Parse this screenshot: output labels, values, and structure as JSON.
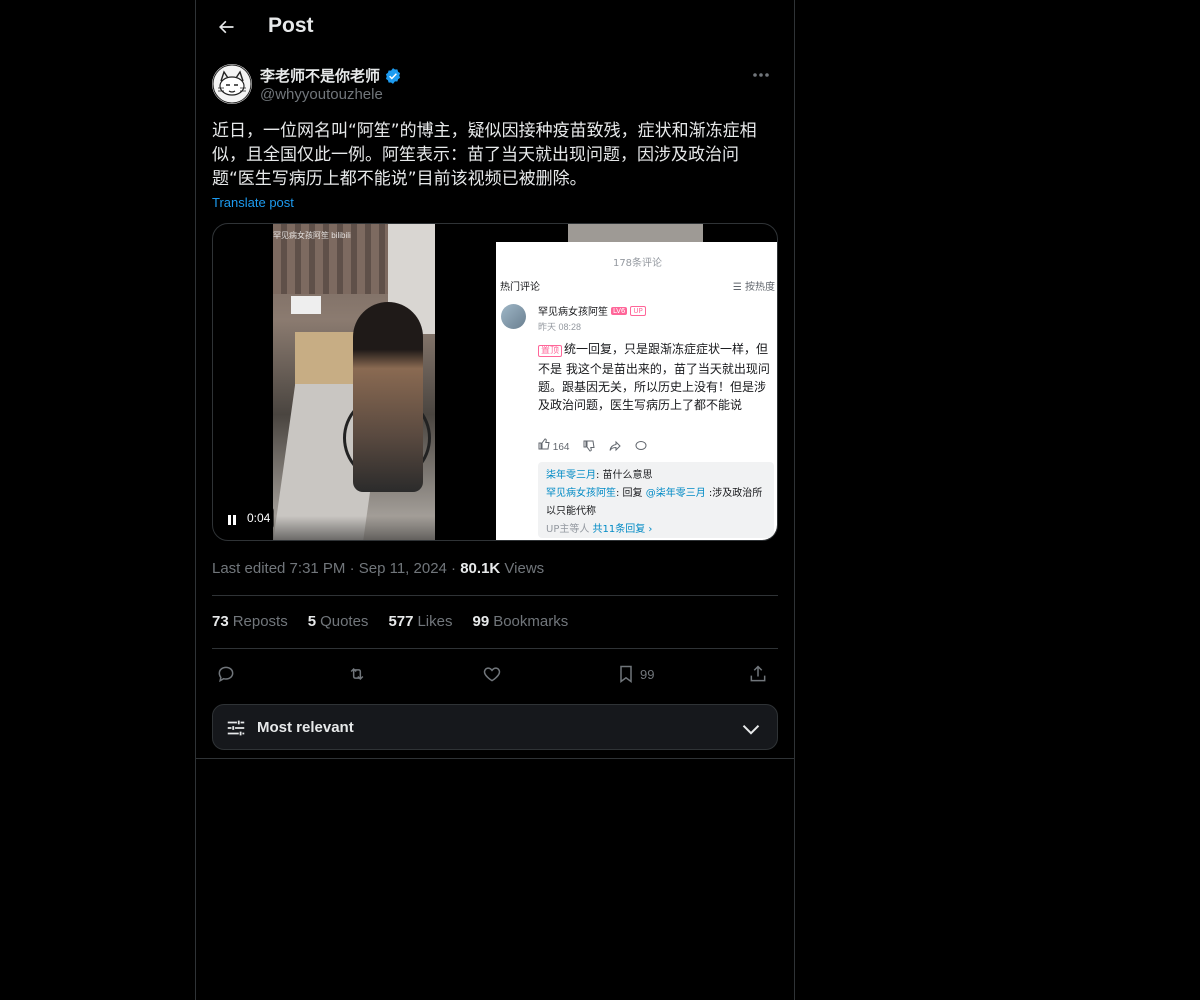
{
  "header": {
    "title": "Post"
  },
  "author": {
    "display_name": "李老师不是你老师",
    "handle": "@whyyoutouzhele",
    "verified": true,
    "verified_color": "#1d9bf0"
  },
  "post": {
    "text": "近日，一位网名叫“阿笙”的博主，疑似因接种疫苗致残，症状和渐冻症相似，且全国仅此一例。阿笙表示：苗了当天就出现问题，因涉及政治问题“医生写病历上都不能说”目前该视频已被删除。",
    "translate_label": "Translate post"
  },
  "media": {
    "timecode": "0:04",
    "video_watermark": "罕见病女孩阿笙 bilibili",
    "screenshot": {
      "comment_count": "178条评论",
      "hot_label": "热门评论",
      "sort_label": "☰ 按热度",
      "username": "罕见病女孩阿笙",
      "level_badge": "LV6",
      "up_badge": "UP",
      "time": "昨天 08:28",
      "pin_label": "置顶",
      "comment": "统一回复，只是跟渐冻症症状一样，但不是 我这个是苗出来的，苗了当天就出现问题。跟基因无关，所以历史上没有！但是涉及政治问题，医生写病历上了都不能说",
      "like_count": "164",
      "reply1_user": "柒年零三月",
      "reply1_text": ": 苗什么意思",
      "reply2_user": "罕见病女孩阿笙",
      "reply2_mid": ": 回复 ",
      "reply2_target": "@柒年零三月",
      "reply2_text": " :涉及政治所以只能代称",
      "more_prefix": "UP主等人 ",
      "more_replies": "共11条回复 ›"
    }
  },
  "meta": {
    "edited": "Last edited 7:31 PM · Sep 11, 2024 · ",
    "views_count": "80.1K",
    "views_label": " Views"
  },
  "stats": {
    "reposts_count": "73",
    "reposts_label": "Reposts",
    "quotes_count": "5",
    "quotes_label": "Quotes",
    "likes_count": "577",
    "likes_label": "Likes",
    "bookmarks_count": "99",
    "bookmarks_label": "Bookmarks"
  },
  "actions": {
    "bookmark_count": "99"
  },
  "sort": {
    "label": "Most relevant"
  },
  "colors": {
    "background": "#000000",
    "accent": "#1d9bf0",
    "border": "#2f3336",
    "muted": "#71767b"
  }
}
